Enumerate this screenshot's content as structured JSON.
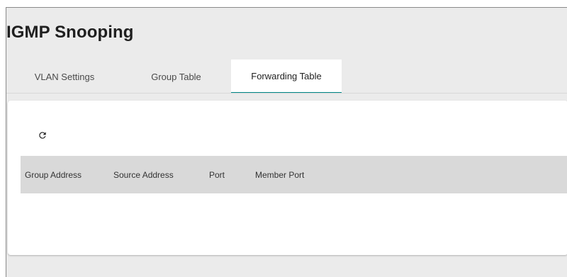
{
  "page": {
    "title": "IGMP Snooping"
  },
  "tabs": [
    {
      "label": "VLAN Settings",
      "active": false
    },
    {
      "label": "Group Table",
      "active": false
    },
    {
      "label": "Forwarding Table",
      "active": true
    }
  ],
  "toolbar": {
    "refresh_icon": "refresh-icon"
  },
  "table": {
    "columns": [
      "Group Address",
      "Source Address",
      "Port",
      "Member Port"
    ],
    "rows": []
  },
  "colors": {
    "accent": "#008787",
    "page_background": "#ebebeb",
    "header_background": "#d9d9d9"
  }
}
